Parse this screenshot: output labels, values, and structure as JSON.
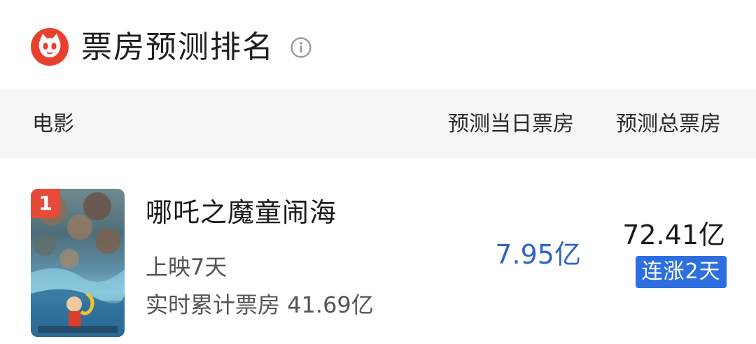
{
  "header": {
    "title": "票房预测排名",
    "logo_icon": "cat-logo-icon",
    "info_icon": "info-icon"
  },
  "table": {
    "columns": {
      "movie": "电影",
      "daily": "预测当日票房",
      "total": "预测总票房"
    },
    "rows": [
      {
        "rank": "1",
        "title": "哪吒之魔童闹海",
        "days_showing": "上映7天",
        "cumulative": "实时累计票房 41.69亿",
        "predicted_daily": "7.95亿",
        "predicted_total": "72.41亿",
        "trend": "连涨2天"
      }
    ]
  },
  "colors": {
    "brand": "#e8402f",
    "accent_blue": "#2f63c8",
    "badge_blue": "#2d6fe0",
    "header_bg": "#f6f6f6"
  }
}
